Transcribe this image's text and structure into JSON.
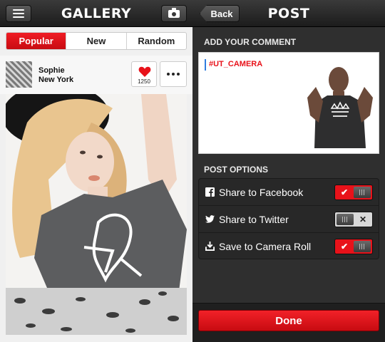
{
  "gallery": {
    "title": "GALLERY",
    "tabs": [
      {
        "label": "Popular",
        "active": true
      },
      {
        "label": "New",
        "active": false
      },
      {
        "label": "Random",
        "active": false
      }
    ],
    "post": {
      "user_name": "Sophie",
      "location": "New York",
      "like_count": "1250",
      "icons": [
        "menu-icon",
        "camera-icon",
        "heart-icon",
        "more-icon"
      ]
    }
  },
  "post_screen": {
    "title": "POST",
    "back_label": "Back",
    "comment_heading": "ADD YOUR COMMENT",
    "comment_text": "#UT_CAMERA",
    "options_heading": "POST OPTIONS",
    "options": [
      {
        "label": "Share to Facebook",
        "icon": "facebook-icon",
        "enabled": true
      },
      {
        "label": "Share to Twitter",
        "icon": "twitter-icon",
        "enabled": false
      },
      {
        "label": "Save to Camera Roll",
        "icon": "download-icon",
        "enabled": true
      }
    ],
    "done_label": "Done"
  },
  "colors": {
    "accent_red": "#e8121a",
    "dark_bg": "#2f2f2f",
    "light_bg": "#f0f0f0"
  }
}
